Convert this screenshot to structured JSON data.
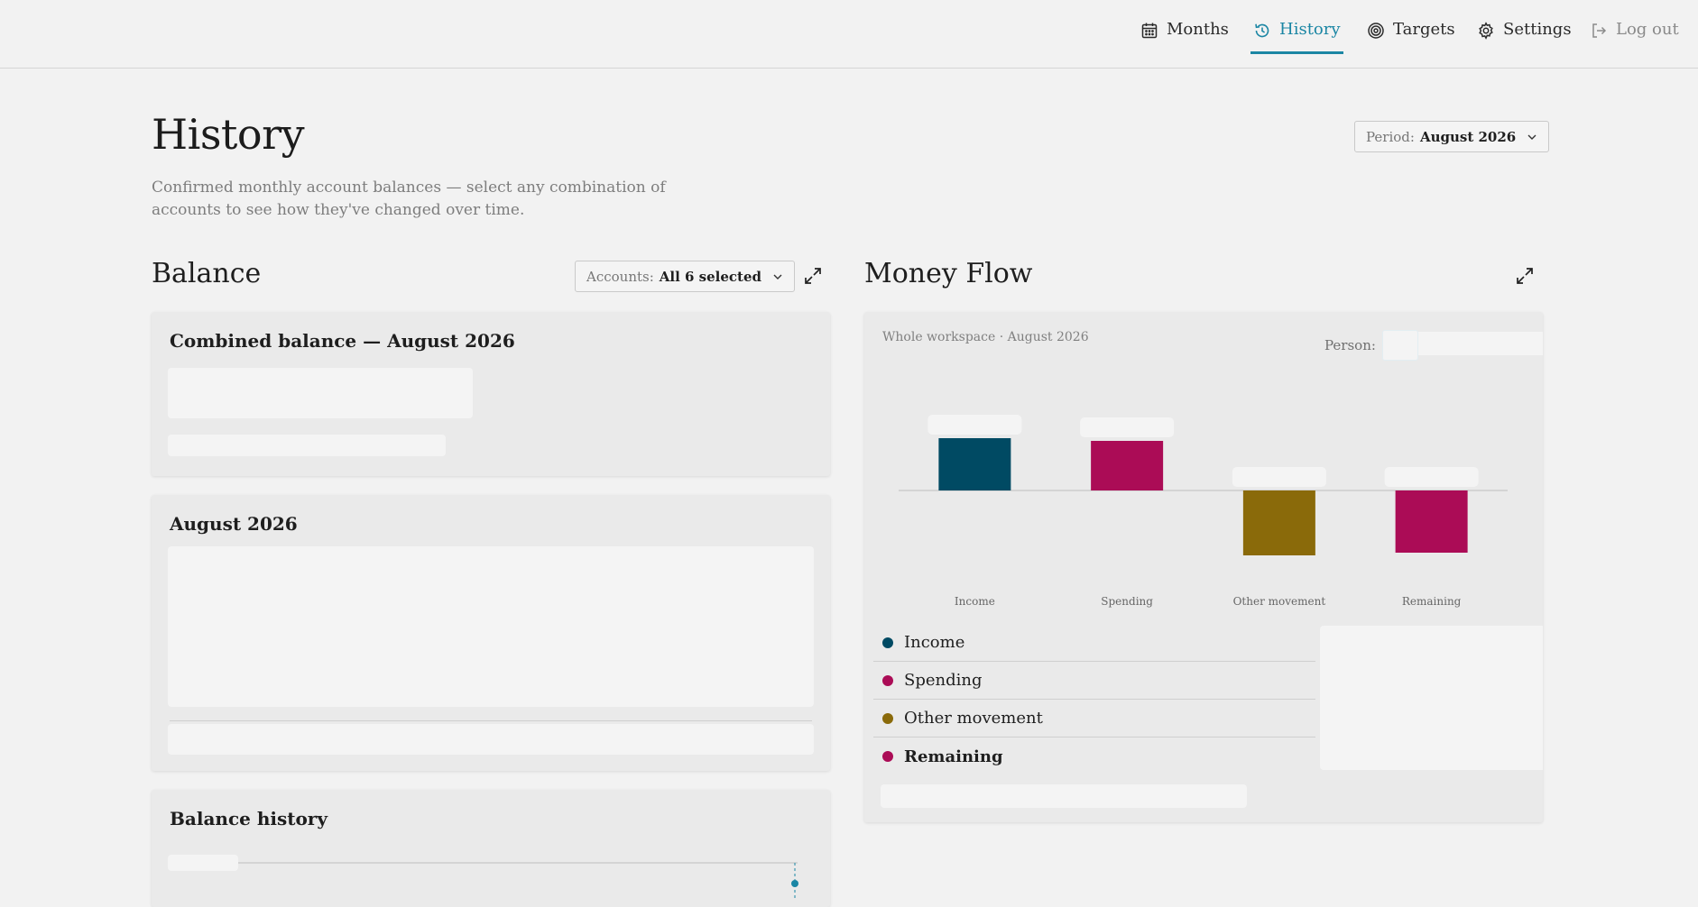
{
  "nav": {
    "months": "Months",
    "history": "History",
    "targets": "Targets",
    "settings": "Settings",
    "logout": "Log out"
  },
  "page": {
    "title": "History",
    "subtitle": "Confirmed monthly account balances — select any combination of accounts to see how they've changed over time.",
    "period_label": "Period:",
    "period_value": "August 2026"
  },
  "balance": {
    "title": "Balance",
    "accounts_label": "Accounts:",
    "accounts_value": "All 6 selected",
    "combined_title": "Combined balance — August 2026",
    "month_title": "August 2026",
    "history_title": "Balance history"
  },
  "money_flow": {
    "title": "Money Flow",
    "subtitle": "Whole workspace · August 2026",
    "person_label": "Person:",
    "legend": [
      {
        "label": "Income",
        "color": "#004a63",
        "bold": false
      },
      {
        "label": "Spending",
        "color": "#ab0c56",
        "bold": false
      },
      {
        "label": "Other movement",
        "color": "#8a6a0a",
        "bold": false
      },
      {
        "label": "Remaining",
        "color": "#ab0c56",
        "bold": true
      }
    ]
  },
  "chart_data": {
    "type": "bar",
    "title": "",
    "xlabel": "",
    "ylabel": "",
    "categories": [
      "Income",
      "Spending",
      "Other movement",
      "Remaining"
    ],
    "values": [
      58,
      55,
      -72,
      -69
    ],
    "ylim": [
      -80,
      80
    ],
    "colors": [
      "#004a63",
      "#ab0c56",
      "#8a6a0a",
      "#ab0c56"
    ],
    "grid": false
  },
  "colors": {
    "accent": "#1b86a4",
    "background": "#f2f2f2",
    "card": "#eaeaea"
  }
}
